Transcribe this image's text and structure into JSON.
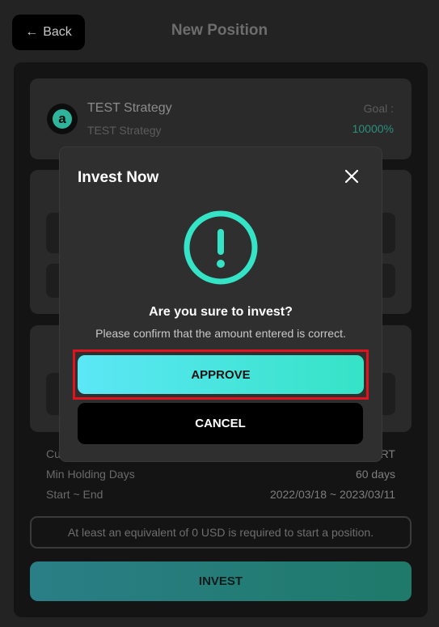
{
  "header": {
    "back_label": "Back",
    "title": "New Position"
  },
  "strategy": {
    "name": "TEST Strategy",
    "subtitle": "TEST Strategy",
    "goal_label": "Goal :",
    "goal_value": "10000%"
  },
  "info": {
    "currency_label": "Cu",
    "currency_value": "RT",
    "min_holding_label": "Min Holding Days",
    "min_holding_value": "60 days",
    "period_label": "Start ~ End",
    "period_value": "2022/03/18 ~ 2023/03/11"
  },
  "notice": "At least an equivalent of 0 USD is required to start a position.",
  "invest_label": "INVEST",
  "modal": {
    "title": "Invest Now",
    "question": "Are you sure to invest?",
    "message": "Please confirm that the amount entered is correct.",
    "approve_label": "APPROVE",
    "cancel_label": "CANCEL",
    "icon": "exclamation-circle-icon"
  },
  "colors": {
    "accent": "#35e3c6",
    "highlight": "#e0141e",
    "goal": "#2b8f7d"
  }
}
